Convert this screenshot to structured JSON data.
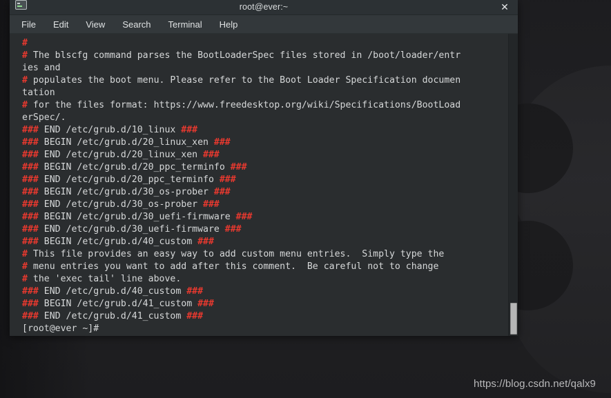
{
  "window": {
    "title": "root@ever:~",
    "icon": "terminal-icon",
    "close_label": "✕"
  },
  "menubar": {
    "items": [
      {
        "label": "File"
      },
      {
        "label": "Edit"
      },
      {
        "label": "View"
      },
      {
        "label": "Search"
      },
      {
        "label": "Terminal"
      },
      {
        "label": "Help"
      }
    ]
  },
  "terminal": {
    "colors": {
      "background": "#2a2d2f",
      "foreground": "#d6d8d9",
      "comment_marker": "#e8392f"
    },
    "lines": [
      {
        "segments": [
          {
            "text": "#",
            "color": "red"
          }
        ]
      },
      {
        "segments": [
          {
            "text": "#",
            "color": "red"
          },
          {
            "text": " The blscfg command parses the BootLoaderSpec files stored in /boot/loader/entr",
            "color": "white"
          }
        ]
      },
      {
        "segments": [
          {
            "text": "ies and",
            "color": "white"
          }
        ]
      },
      {
        "segments": [
          {
            "text": "#",
            "color": "red"
          },
          {
            "text": " populates the boot menu. Please refer to the Boot Loader Specification documen",
            "color": "white"
          }
        ]
      },
      {
        "segments": [
          {
            "text": "tation",
            "color": "white"
          }
        ]
      },
      {
        "segments": [
          {
            "text": "#",
            "color": "red"
          },
          {
            "text": " for the files format: https://www.freedesktop.org/wiki/Specifications/BootLoad",
            "color": "white"
          }
        ]
      },
      {
        "segments": [
          {
            "text": "erSpec/.",
            "color": "white"
          }
        ]
      },
      {
        "segments": [
          {
            "text": "###",
            "color": "red"
          },
          {
            "text": " END /etc/grub.d/10_linux ",
            "color": "white"
          },
          {
            "text": "###",
            "color": "red"
          }
        ]
      },
      {
        "segments": [
          {
            "text": "###",
            "color": "red"
          },
          {
            "text": " BEGIN /etc/grub.d/20_linux_xen ",
            "color": "white"
          },
          {
            "text": "###",
            "color": "red"
          }
        ]
      },
      {
        "segments": [
          {
            "text": "###",
            "color": "red"
          },
          {
            "text": " END /etc/grub.d/20_linux_xen ",
            "color": "white"
          },
          {
            "text": "###",
            "color": "red"
          }
        ]
      },
      {
        "segments": [
          {
            "text": "###",
            "color": "red"
          },
          {
            "text": " BEGIN /etc/grub.d/20_ppc_terminfo ",
            "color": "white"
          },
          {
            "text": "###",
            "color": "red"
          }
        ]
      },
      {
        "segments": [
          {
            "text": "###",
            "color": "red"
          },
          {
            "text": " END /etc/grub.d/20_ppc_terminfo ",
            "color": "white"
          },
          {
            "text": "###",
            "color": "red"
          }
        ]
      },
      {
        "segments": [
          {
            "text": "###",
            "color": "red"
          },
          {
            "text": " BEGIN /etc/grub.d/30_os-prober ",
            "color": "white"
          },
          {
            "text": "###",
            "color": "red"
          }
        ]
      },
      {
        "segments": [
          {
            "text": "###",
            "color": "red"
          },
          {
            "text": " END /etc/grub.d/30_os-prober ",
            "color": "white"
          },
          {
            "text": "###",
            "color": "red"
          }
        ]
      },
      {
        "segments": [
          {
            "text": "###",
            "color": "red"
          },
          {
            "text": " BEGIN /etc/grub.d/30_uefi-firmware ",
            "color": "white"
          },
          {
            "text": "###",
            "color": "red"
          }
        ]
      },
      {
        "segments": [
          {
            "text": "###",
            "color": "red"
          },
          {
            "text": " END /etc/grub.d/30_uefi-firmware ",
            "color": "white"
          },
          {
            "text": "###",
            "color": "red"
          }
        ]
      },
      {
        "segments": [
          {
            "text": "###",
            "color": "red"
          },
          {
            "text": " BEGIN /etc/grub.d/40_custom ",
            "color": "white"
          },
          {
            "text": "###",
            "color": "red"
          }
        ]
      },
      {
        "segments": [
          {
            "text": "#",
            "color": "red"
          },
          {
            "text": " This file provides an easy way to add custom menu entries.  Simply type the",
            "color": "white"
          }
        ]
      },
      {
        "segments": [
          {
            "text": "#",
            "color": "red"
          },
          {
            "text": " menu entries you want to add after this comment.  Be careful not to change",
            "color": "white"
          }
        ]
      },
      {
        "segments": [
          {
            "text": "#",
            "color": "red"
          },
          {
            "text": " the 'exec tail' line above.",
            "color": "white"
          }
        ]
      },
      {
        "segments": [
          {
            "text": "###",
            "color": "red"
          },
          {
            "text": " END /etc/grub.d/40_custom ",
            "color": "white"
          },
          {
            "text": "###",
            "color": "red"
          }
        ]
      },
      {
        "segments": [
          {
            "text": "###",
            "color": "red"
          },
          {
            "text": " BEGIN /etc/grub.d/41_custom ",
            "color": "white"
          },
          {
            "text": "###",
            "color": "red"
          }
        ]
      },
      {
        "segments": [
          {
            "text": "###",
            "color": "red"
          },
          {
            "text": " END /etc/grub.d/41_custom ",
            "color": "white"
          },
          {
            "text": "###",
            "color": "red"
          }
        ]
      },
      {
        "segments": [
          {
            "text": "[root@ever ~]#",
            "color": "white"
          }
        ]
      }
    ]
  },
  "desktop": {
    "watermark": "https://blog.csdn.net/qalx9"
  }
}
